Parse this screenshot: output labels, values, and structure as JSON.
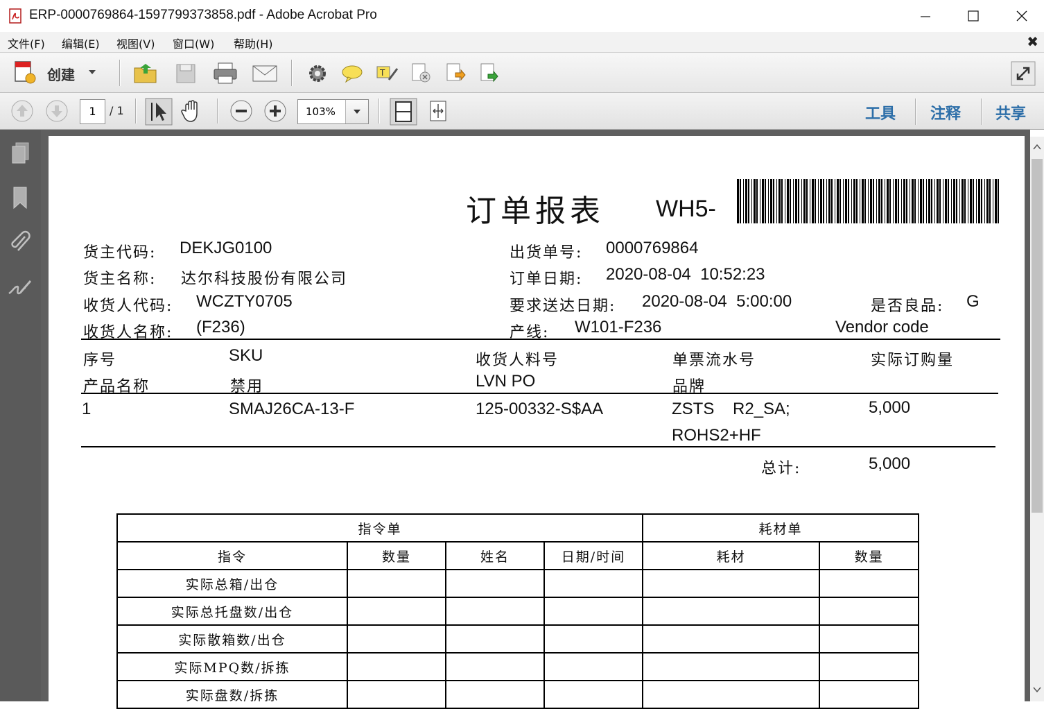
{
  "window": {
    "title": "ERP-0000769864-1597799373858.pdf - Adobe Acrobat Pro",
    "menu": [
      "文件(F)",
      "编辑(E)",
      "视图(V)",
      "窗口(W)",
      "帮助(H)"
    ]
  },
  "toolbar": {
    "create_label": "创建",
    "page_current": "1",
    "page_total": "/ 1",
    "zoom": "103%",
    "links": {
      "tools": "工具",
      "comment": "注释",
      "share": "共享"
    }
  },
  "doc": {
    "title": "订单报表",
    "barcode_prefix": "WH5-",
    "fields": {
      "owner_code_label": "货主代码:",
      "owner_code": "DEKJG0100",
      "owner_name_label": "货主名称:",
      "owner_name": "达尔科技股份有限公司",
      "consignee_code_label": "收货人代码:",
      "consignee_code": "WCZTY0705",
      "consignee_name_label": "收货人名称:",
      "consignee_name": "(F236)",
      "ship_no_label": "出货单号:",
      "ship_no": "0000769864",
      "order_date_label": "订单日期:",
      "order_date": "2020-08-04  10:52:23",
      "delivery_date_label": "要求送达日期:",
      "delivery_date": "2020-08-04  5:00:00",
      "line_label": "产线:",
      "line": "W101-F236",
      "quality_label": "是否良品:",
      "quality": "G",
      "vendor_code_label": "Vendor code"
    },
    "headers": {
      "seq": "序号",
      "sku": "SKU",
      "consignee_part": "收货人料号",
      "serial": "单票流水号",
      "actual_qty": "实际订购量",
      "product_name": "产品名称",
      "disabled": "禁用",
      "lvn_po": "LVN PO",
      "brand": "品牌"
    },
    "rows": [
      {
        "seq": "1",
        "sku": "SMAJ26CA-13-F",
        "consignee_part": "125-00332-S$AA",
        "serial_line1": "ZSTS    R2_SA;",
        "serial_line2": "ROHS2+HF",
        "qty": "5,000"
      }
    ],
    "total_label": "总计:",
    "total": "5,000",
    "grid": {
      "group_instr": "指令单",
      "group_material": "耗材单",
      "cols": [
        "指令",
        "数量",
        "姓名",
        "日期/时间",
        "耗材",
        "数量"
      ],
      "rows": [
        "实际总箱/出仓",
        "实际总托盘数/出仓",
        "实际散箱数/出仓",
        "实际MPQ数/拆拣",
        "实际盘数/拆拣"
      ]
    }
  }
}
